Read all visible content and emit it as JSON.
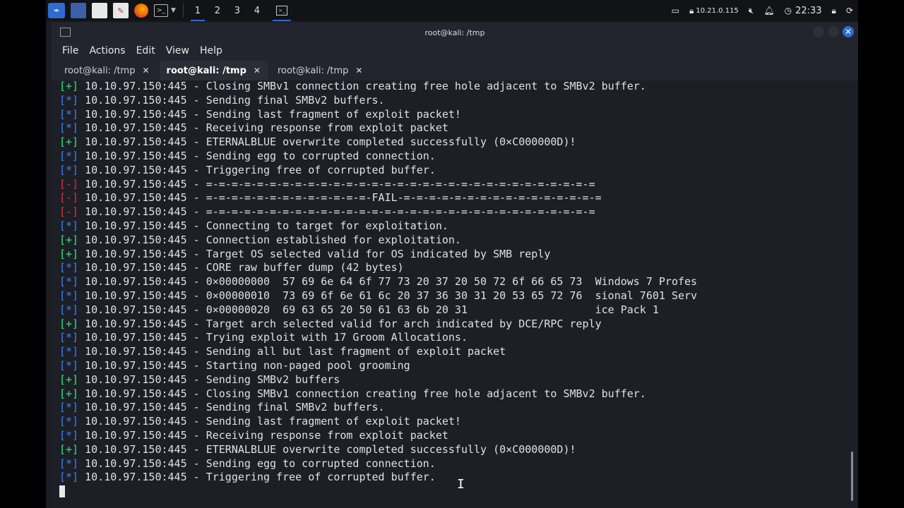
{
  "panel": {
    "kali_menu_icon": "kali-dragon-icon",
    "workspaces": [
      "1",
      "2",
      "3",
      "4"
    ],
    "active_workspace": "1",
    "ip_address": "10.21.0.115",
    "clock": "22:33"
  },
  "window": {
    "title": "root@kali: /tmp",
    "menu": [
      "File",
      "Actions",
      "Edit",
      "View",
      "Help"
    ],
    "tabs": [
      {
        "label": "root@kali: /tmp",
        "active": false
      },
      {
        "label": "root@kali: /tmp",
        "active": true
      },
      {
        "label": "root@kali: /tmp",
        "active": false
      }
    ]
  },
  "colors": {
    "plus": "#2ee57a",
    "star": "#3d7ff0",
    "minus": "#e03030",
    "accent": "#2f6ccd"
  },
  "terminal": {
    "lines": [
      {
        "marker": "+",
        "host": "10.10.97.150:445",
        "message": "Closing SMBv1 connection creating free hole adjacent to SMBv2 buffer."
      },
      {
        "marker": "*",
        "host": "10.10.97.150:445",
        "message": "Sending final SMBv2 buffers."
      },
      {
        "marker": "*",
        "host": "10.10.97.150:445",
        "message": "Sending last fragment of exploit packet!"
      },
      {
        "marker": "*",
        "host": "10.10.97.150:445",
        "message": "Receiving response from exploit packet"
      },
      {
        "marker": "+",
        "host": "10.10.97.150:445",
        "message": "ETERNALBLUE overwrite completed successfully (0×C000000D)!"
      },
      {
        "marker": "*",
        "host": "10.10.97.150:445",
        "message": "Sending egg to corrupted connection."
      },
      {
        "marker": "*",
        "host": "10.10.97.150:445",
        "message": "Triggering free of corrupted buffer."
      },
      {
        "marker": "-",
        "host": "10.10.97.150:445",
        "message": "=-=-=-=-=-=-=-=-=-=-=-=-=-=-=-=-=-=-=-=-=-=-=-=-=-=-=-=-=-=-="
      },
      {
        "marker": "-",
        "host": "10.10.97.150:445",
        "message": "=-=-=-=-=-=-=-=-=-=-=-=-=-FAIL-=-=-=-=-=-=-=-=-=-=-=-=-=-=-=-="
      },
      {
        "marker": "-",
        "host": "10.10.97.150:445",
        "message": "=-=-=-=-=-=-=-=-=-=-=-=-=-=-=-=-=-=-=-=-=-=-=-=-=-=-=-=-=-=-="
      },
      {
        "marker": "*",
        "host": "10.10.97.150:445",
        "message": "Connecting to target for exploitation."
      },
      {
        "marker": "+",
        "host": "10.10.97.150:445",
        "message": "Connection established for exploitation."
      },
      {
        "marker": "+",
        "host": "10.10.97.150:445",
        "message": "Target OS selected valid for OS indicated by SMB reply"
      },
      {
        "marker": "*",
        "host": "10.10.97.150:445",
        "message": "CORE raw buffer dump (42 bytes)"
      },
      {
        "marker": "*",
        "host": "10.10.97.150:445",
        "message": "0×00000000  57 69 6e 64 6f 77 73 20 37 20 50 72 6f 66 65 73  Windows 7 Profes"
      },
      {
        "marker": "*",
        "host": "10.10.97.150:445",
        "message": "0×00000010  73 69 6f 6e 61 6c 20 37 36 30 31 20 53 65 72 76  sional 7601 Serv"
      },
      {
        "marker": "*",
        "host": "10.10.97.150:445",
        "message": "0×00000020  69 63 65 20 50 61 63 6b 20 31                    ice Pack 1"
      },
      {
        "marker": "+",
        "host": "10.10.97.150:445",
        "message": "Target arch selected valid for arch indicated by DCE/RPC reply"
      },
      {
        "marker": "*",
        "host": "10.10.97.150:445",
        "message": "Trying exploit with 17 Groom Allocations."
      },
      {
        "marker": "*",
        "host": "10.10.97.150:445",
        "message": "Sending all but last fragment of exploit packet"
      },
      {
        "marker": "*",
        "host": "10.10.97.150:445",
        "message": "Starting non-paged pool grooming"
      },
      {
        "marker": "+",
        "host": "10.10.97.150:445",
        "message": "Sending SMBv2 buffers"
      },
      {
        "marker": "+",
        "host": "10.10.97.150:445",
        "message": "Closing SMBv1 connection creating free hole adjacent to SMBv2 buffer."
      },
      {
        "marker": "*",
        "host": "10.10.97.150:445",
        "message": "Sending final SMBv2 buffers."
      },
      {
        "marker": "*",
        "host": "10.10.97.150:445",
        "message": "Sending last fragment of exploit packet!"
      },
      {
        "marker": "*",
        "host": "10.10.97.150:445",
        "message": "Receiving response from exploit packet"
      },
      {
        "marker": "+",
        "host": "10.10.97.150:445",
        "message": "ETERNALBLUE overwrite completed successfully (0×C000000D)!"
      },
      {
        "marker": "*",
        "host": "10.10.97.150:445",
        "message": "Sending egg to corrupted connection."
      },
      {
        "marker": "*",
        "host": "10.10.97.150:445",
        "message": "Triggering free of corrupted buffer."
      }
    ]
  }
}
